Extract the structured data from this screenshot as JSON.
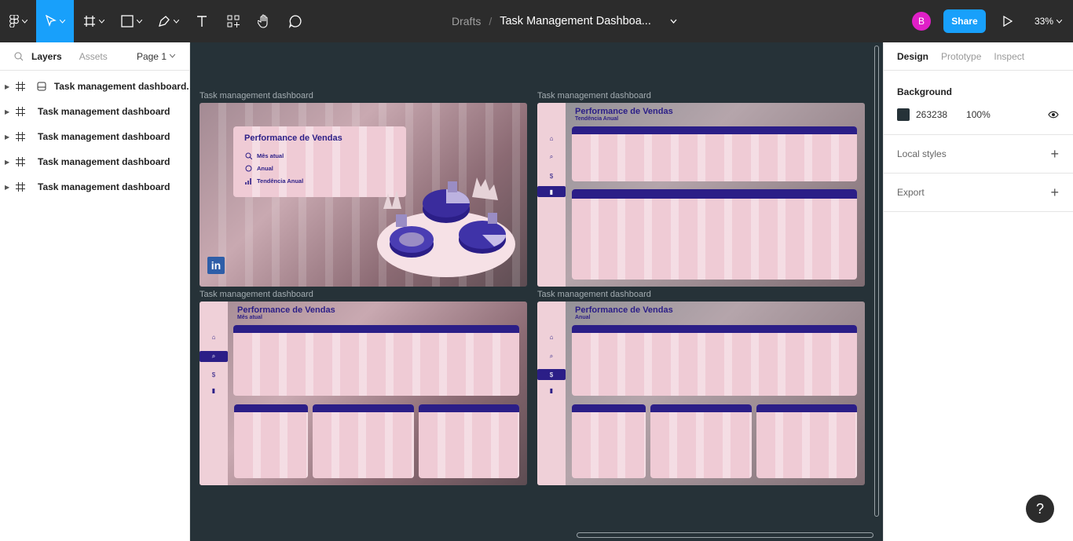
{
  "toolbar": {
    "tools": [
      "figma-menu",
      "move",
      "frame",
      "shape",
      "pen",
      "text",
      "resources",
      "hand",
      "comment"
    ],
    "breadcrumb_parent": "Drafts",
    "breadcrumb_sep": "/",
    "file_name": "Task Management Dashboa...",
    "avatar_initial": "B",
    "share_label": "Share",
    "zoom": "33%"
  },
  "left_panel": {
    "tab_layers": "Layers",
    "tab_assets": "Assets",
    "page": "Page 1",
    "layers": [
      {
        "name": "Task management dashboard...",
        "has_component": true
      },
      {
        "name": "Task management dashboard"
      },
      {
        "name": "Task management dashboard"
      },
      {
        "name": "Task management dashboard"
      },
      {
        "name": "Task management dashboard"
      }
    ]
  },
  "canvas": {
    "background": "#263238",
    "frames": [
      {
        "label": "Task management dashboard",
        "title": "Performance de Vendas",
        "menu": [
          "Mês atual",
          "Anual",
          "Tendência Anual"
        ],
        "logo": "in"
      },
      {
        "label": "Task management dashboard",
        "title": "Performance de Vendas",
        "subtitle": "Tendência Anual"
      },
      {
        "label": "Task management dashboard",
        "title": "Performance de Vendas",
        "subtitle": "Mês atual"
      },
      {
        "label": "Task management dashboard",
        "title": "Performance de Vendas",
        "subtitle": "Anual"
      }
    ]
  },
  "right_panel": {
    "tab_design": "Design",
    "tab_prototype": "Prototype",
    "tab_inspect": "Inspect",
    "background_heading": "Background",
    "bg_hex": "263238",
    "bg_opacity": "100%",
    "local_styles": "Local styles",
    "export": "Export"
  },
  "help": "?",
  "colors": {
    "accent": "#18a0fb",
    "avatar": "#e01fc7",
    "dashboard_navy": "#2b1e87",
    "card_pink": "#efcbd5"
  }
}
